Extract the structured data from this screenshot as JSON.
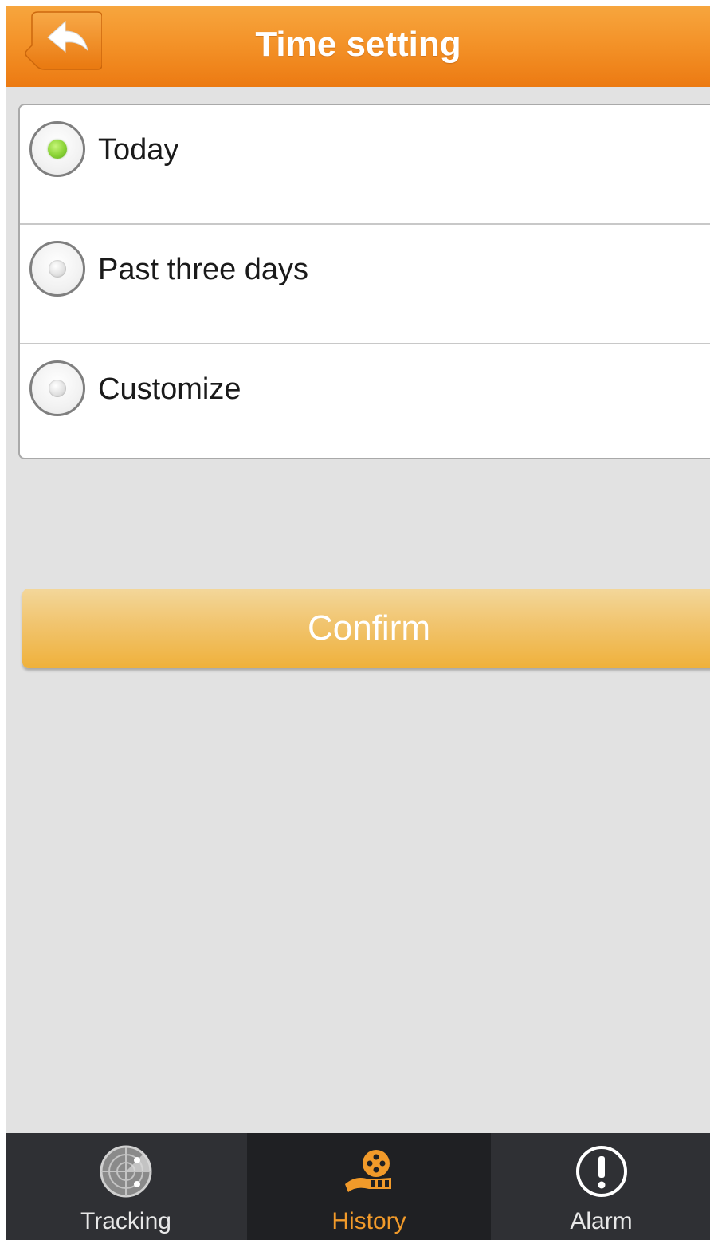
{
  "header": {
    "title": "Time setting",
    "back_icon": "back-arrow-icon"
  },
  "options": [
    {
      "label": "Today",
      "checked": true
    },
    {
      "label": "Past three days",
      "checked": false
    },
    {
      "label": "Customize",
      "checked": false
    }
  ],
  "confirm_label": "Confirm",
  "nav": {
    "items": [
      {
        "label": "Tracking",
        "icon": "radar-icon",
        "active": false
      },
      {
        "label": "History",
        "icon": "film-reel-icon",
        "active": true
      },
      {
        "label": "Alarm",
        "icon": "alert-icon",
        "active": false
      }
    ]
  },
  "colors": {
    "header": "#f39127",
    "accent": "#f19a2a",
    "confirm": "#efb13b",
    "radio_checked": "#8fd63a",
    "nav_background": "#2f3034"
  }
}
